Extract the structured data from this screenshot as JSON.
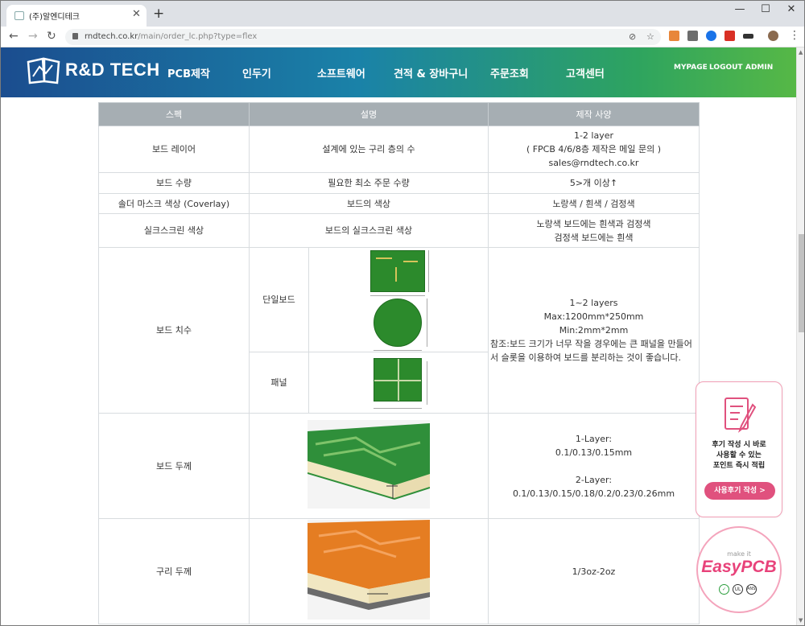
{
  "browser": {
    "tab_title": "(주)알엔디테크",
    "url_host": "rndtech.co.kr",
    "url_path": "/main/order_lc.php?type=flex",
    "colors": {
      "tabstrip": "#dee1e6",
      "omnibox": "#f1f3f4"
    }
  },
  "header": {
    "logo_text": "R&D TECH",
    "nav": [
      "PCB제작",
      "인두기",
      "소프트웨어",
      "견적 & 장바구니",
      "주문조회",
      "고객센터"
    ],
    "util": [
      "MYPAGE",
      "LOGOUT",
      "ADMIN"
    ],
    "colors": {
      "gradient_start": "#1b4d8f",
      "gradient_end": "#56b846"
    }
  },
  "table": {
    "headers": [
      "스펙",
      "설명",
      "제작 사양"
    ],
    "board_layer": {
      "label": "보드 레이어",
      "desc": "설계에 있는 구리 층의 수",
      "spec_line1": "1-2 layer",
      "spec_line2": "( FPCB 4/6/8층 제작은 메일 문의 )",
      "spec_line3": "sales@rndtech.co.kr"
    },
    "board_qty": {
      "label": "보드 수량",
      "desc": "필요한 최소 주문 수량",
      "spec": "5>개 이상↑"
    },
    "solder_mask": {
      "label": "솔더 마스크 색상 (Coverlay)",
      "desc": "보드의 색상",
      "spec": "노랑색 / 흰색 / 검정색"
    },
    "silkscreen": {
      "label": "실크스크린 색상",
      "desc": "보드의 실크스크린 색상",
      "spec_line1": "노랑색 보드에는 흰색과 검정색",
      "spec_line2": "검정색 보드에는 흰색"
    },
    "board_size": {
      "label": "보드 치수",
      "single_label": "단일보드",
      "panel_label": "패널",
      "spec_line1": "1~2 layers",
      "spec_line2": "Max:1200mm*250mm",
      "spec_line3": "Min:2mm*2mm",
      "note": "참조:보드 크기가 너무 작을 경우에는 큰 패널을 만들어서 슬롯을 이용하여 보드를 분리하는 것이 좋습니다."
    },
    "board_thickness": {
      "label": "보드 두께",
      "spec_1_title": "1-Layer:",
      "spec_1_values": "0.1/0.13/0.15mm",
      "spec_2_title": "2-Layer:",
      "spec_2_values": "0.1/0.13/0.15/0.18/0.2/0.23/0.26mm"
    },
    "copper_thickness": {
      "label": "구리 두께",
      "spec": "1/3oz-2oz"
    }
  },
  "widgets": {
    "review_line1": "후기 작성 시 바로",
    "review_line2": "사용할 수 있는",
    "review_line3": "포인트 즉시 적립",
    "review_button": "사용후기 작성 >",
    "easy_small": "make it",
    "easy_logo": "EasyPCB",
    "certs": [
      "✓",
      "UL",
      "ANSI"
    ]
  }
}
